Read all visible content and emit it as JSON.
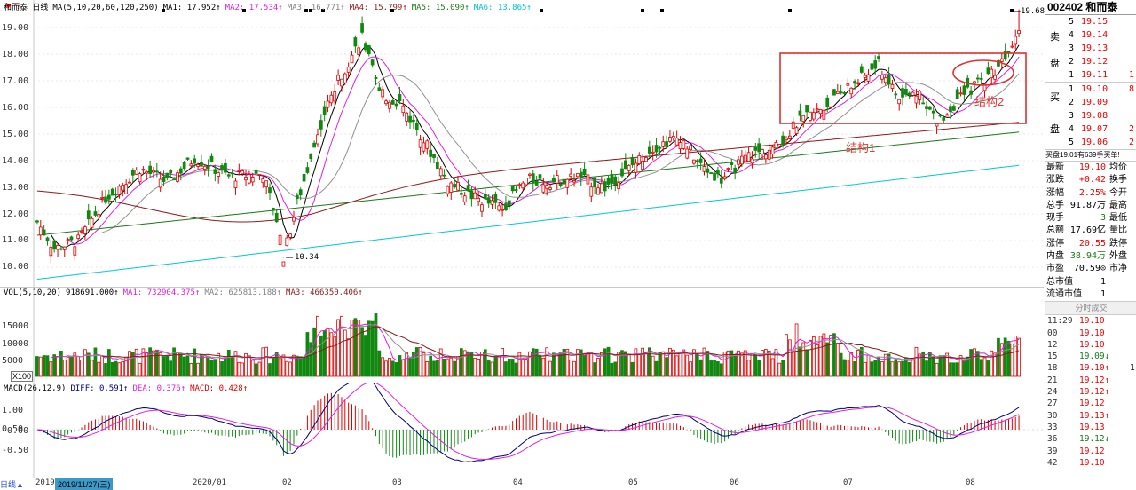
{
  "price_panel": {
    "legend": [
      {
        "text": "和而泰 日线",
        "color": "#000000"
      },
      {
        "text": "MA(5,10,20,60,120,250)",
        "color": "#000000"
      },
      {
        "text": "MA1: 17.952↑",
        "color": "#000000"
      },
      {
        "text": "MA2: 17.534↑",
        "color": "#e020e0"
      },
      {
        "text": "MA3: 16.771↑",
        "color": "#808080"
      },
      {
        "text": "MA4: 15.799↑",
        "color": "#8b1a1a"
      },
      {
        "text": "MA5: 15.090↑",
        "color": "#1a7a1a"
      },
      {
        "text": "MA6: 13.865↑",
        "color": "#00c0d0"
      }
    ],
    "y_ticks": [
      "19.00",
      "18.00",
      "17.00",
      "16.00",
      "15.00",
      "14.00",
      "13.00",
      "12.00",
      "11.00",
      "10.00"
    ],
    "high_label": "19.68",
    "low_label": "10.34",
    "annotations": {
      "structure1": "结构1",
      "structure2": "结构2"
    }
  },
  "vol_panel": {
    "legend": [
      {
        "text": "VOL(5,10,20)",
        "color": "#000000"
      },
      {
        "text": "918691.000↑",
        "color": "#000000"
      },
      {
        "text": "MA1: 732904.375↑",
        "color": "#e020e0"
      },
      {
        "text": "MA2: 625813.188↑",
        "color": "#808080"
      },
      {
        "text": "MA3: 466350.406↑",
        "color": "#8b1a1a"
      }
    ],
    "y_ticks": [
      "15000",
      "10000",
      "5000"
    ],
    "unit": "X100"
  },
  "macd_panel": {
    "legend": [
      {
        "text": "MACD(26,12,9)",
        "color": "#000000"
      },
      {
        "text": "DIFF: 0.591↑",
        "color": "#000080"
      },
      {
        "text": "DEA: 0.376↑",
        "color": "#e020e0"
      },
      {
        "text": "MACD: 0.428↑",
        "color": "#e00000"
      }
    ],
    "y_ticks": [
      "1.00",
      "0.50",
      "-0.00",
      "-0.50"
    ]
  },
  "x_axis": {
    "mark": "日线▲",
    "highlight": "2019/11/27(三)",
    "labels": [
      "2019",
      "2020/01",
      "02",
      "03",
      "04",
      "05",
      "06",
      "07",
      "08"
    ]
  },
  "side": {
    "code": "002402 和而泰",
    "sell_label_1": "卖",
    "sell_label_2": "盘",
    "buy_label_1": "买",
    "buy_label_2": "盘",
    "asks": [
      {
        "n": "5",
        "p": "19.15",
        "q": ""
      },
      {
        "n": "4",
        "p": "19.14",
        "q": ""
      },
      {
        "n": "3",
        "p": "19.13",
        "q": ""
      },
      {
        "n": "2",
        "p": "19.12",
        "q": ""
      },
      {
        "n": "1",
        "p": "19.11",
        "q": "1"
      }
    ],
    "bids": [
      {
        "n": "1",
        "p": "19.10",
        "q": "8"
      },
      {
        "n": "2",
        "p": "19.09",
        "q": ""
      },
      {
        "n": "3",
        "p": "19.08",
        "q": ""
      },
      {
        "n": "4",
        "p": "19.07",
        "q": "2"
      },
      {
        "n": "5",
        "p": "19.06",
        "q": "2"
      }
    ],
    "hint": "买盘19.01有639手买单!",
    "stats": [
      {
        "k": "最新",
        "v": "19.10",
        "k2": "均价",
        "c": "#e00"
      },
      {
        "k": "涨跌",
        "v": "+0.42",
        "k2": "换手",
        "c": "#e00"
      },
      {
        "k": "涨幅",
        "v": "2.25%",
        "k2": "今开",
        "c": "#e00"
      },
      {
        "k": "总手",
        "v": "91.87万",
        "k2": "最高",
        "c": "#000"
      },
      {
        "k": "现手",
        "v": "3",
        "k2": "最低",
        "c": "#1a7a1a"
      },
      {
        "k": "总额",
        "v": "17.69亿",
        "k2": "量比",
        "c": "#000"
      },
      {
        "k": "涨停",
        "v": "20.55",
        "k2": "跌停",
        "c": "#e00"
      },
      {
        "k": "内盘",
        "v": "38.94万",
        "k2": "外盘",
        "c": "#1a7a1a"
      },
      {
        "k": "市盈",
        "v": "70.59⊙",
        "k2": "市净",
        "c": "#000"
      },
      {
        "k": "总市值",
        "v": "1",
        "k2": "",
        "c": "#000"
      },
      {
        "k": "流通市值",
        "v": "1",
        "k2": "",
        "c": "#000"
      }
    ],
    "trades_header": "分时成交",
    "trades": [
      {
        "t": "11:29",
        "p": "19.10",
        "v": "",
        "c": "#e00"
      },
      {
        "t": "00",
        "p": "19.10",
        "v": "",
        "c": "#e00"
      },
      {
        "t": "12",
        "p": "19.10",
        "v": "",
        "c": "#e00"
      },
      {
        "t": "15",
        "p": "19.09↓",
        "v": "",
        "c": "#1a7a1a"
      },
      {
        "t": "18",
        "p": "19.10↑",
        "v": "1",
        "c": "#e00"
      },
      {
        "t": "21",
        "p": "19.12↑",
        "v": "",
        "c": "#e00"
      },
      {
        "t": "24",
        "p": "19.12↑",
        "v": "",
        "c": "#e00"
      },
      {
        "t": "27",
        "p": "19.12",
        "v": "",
        "c": "#e00"
      },
      {
        "t": "30",
        "p": "19.13↑",
        "v": "",
        "c": "#e00"
      },
      {
        "t": "33",
        "p": "19.13",
        "v": "",
        "c": "#e00"
      },
      {
        "t": "36",
        "p": "19.12↓",
        "v": "",
        "c": "#1a7a1a"
      },
      {
        "t": "39",
        "p": "19.12",
        "v": "",
        "c": "#e00"
      },
      {
        "t": "42",
        "p": "19.10",
        "v": "",
        "c": "#e00"
      }
    ]
  }
}
